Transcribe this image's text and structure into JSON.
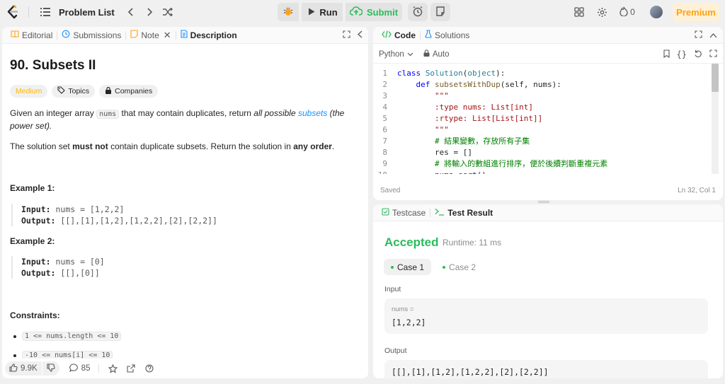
{
  "nav": {
    "title": "Problem List",
    "run_label": "Run",
    "submit_label": "Submit",
    "streak_count": "0",
    "premium_label": "Premium"
  },
  "left_tabs": [
    {
      "label": "Editorial",
      "icon": "book-icon"
    },
    {
      "label": "Submissions",
      "icon": "history-icon"
    },
    {
      "label": "Note",
      "icon": "note-icon"
    },
    {
      "label": "Description",
      "icon": "document-icon"
    }
  ],
  "problem": {
    "title": "90. Subsets II",
    "difficulty": "Medium",
    "topics_label": "Topics",
    "companies_label": "Companies",
    "desc_pre": "Given an integer array ",
    "desc_code": "nums",
    "desc_mid": " that may contain duplicates, return ",
    "desc_em": "all possible ",
    "desc_link": "subsets",
    "desc_post": " (the power set).",
    "p2_pre": "The solution set ",
    "p2_b1": "must not",
    "p2_mid": " contain duplicate subsets. Return the solution in ",
    "p2_b2": "any order",
    "p2_post": ".",
    "examples": [
      {
        "heading": "Example 1:",
        "input_label": "Input:",
        "input": " nums = [1,2,2]",
        "output_label": "Output:",
        "output": " [[],[1],[1,2],[1,2,2],[2],[2,2]]"
      },
      {
        "heading": "Example 2:",
        "input_label": "Input:",
        "input": " nums = [0]",
        "output_label": "Output:",
        "output": " [[],[0]]"
      }
    ],
    "constraints_heading": "Constraints:",
    "constraints": [
      "1 <= nums.length <= 10",
      "-10 <= nums[i] <= 10"
    ]
  },
  "footer": {
    "likes": "9.9K",
    "comments": "85"
  },
  "code_tabs": [
    {
      "label": "Code",
      "icon": "code-icon"
    },
    {
      "label": "Solutions",
      "icon": "flask-icon"
    }
  ],
  "editor": {
    "language": "Python",
    "mode": "Auto",
    "status_left": "Saved",
    "status_right": "Ln 32, Col 1",
    "lines": [
      {
        "n": "1",
        "parts": [
          [
            "kw",
            "class "
          ],
          [
            "bi",
            "Solution"
          ],
          [
            "pl",
            "("
          ],
          [
            "bi",
            "object"
          ],
          [
            "pl",
            "):"
          ]
        ]
      },
      {
        "n": "2",
        "parts": [
          [
            "pl",
            "    "
          ],
          [
            "kw",
            "def "
          ],
          [
            "fn",
            "subsetsWithDup"
          ],
          [
            "pl",
            "(self, nums):"
          ]
        ]
      },
      {
        "n": "3",
        "parts": [
          [
            "str",
            "        \"\"\""
          ]
        ]
      },
      {
        "n": "4",
        "parts": [
          [
            "str",
            "        :type nums: List[int]"
          ]
        ]
      },
      {
        "n": "5",
        "parts": [
          [
            "str",
            "        :rtype: List[List[int]]"
          ]
        ]
      },
      {
        "n": "6",
        "parts": [
          [
            "str",
            "        \"\"\""
          ]
        ]
      },
      {
        "n": "7",
        "parts": [
          [
            "cm",
            "        # 結果變數，存放所有子集"
          ]
        ]
      },
      {
        "n": "8",
        "parts": [
          [
            "pl",
            "        res = []"
          ]
        ]
      },
      {
        "n": "9",
        "parts": [
          [
            "cm",
            "        # 將輸入的數組進行排序，便於後續判斷重複元素"
          ]
        ]
      },
      {
        "n": "10",
        "parts": [
          [
            "pl",
            "        nums.sort()"
          ]
        ]
      }
    ]
  },
  "result_tabs": [
    {
      "label": "Testcase",
      "icon": "checkbox-icon"
    },
    {
      "label": "Test Result",
      "icon": "terminal-icon"
    }
  ],
  "result": {
    "status": "Accepted",
    "runtime": "Runtime: 11 ms",
    "cases": [
      "Case 1",
      "Case 2"
    ],
    "input_label": "Input",
    "input_var": "nums =",
    "input_value": "[1,2,2]",
    "output_label": "Output",
    "output_value": "[[],[1],[1,2],[1,2,2],[2],[2,2]]"
  },
  "colors": {
    "accent_green": "#2cbb5d",
    "medium": "#ffb800",
    "premium": "#ffa116",
    "link": "#1a90ff"
  }
}
